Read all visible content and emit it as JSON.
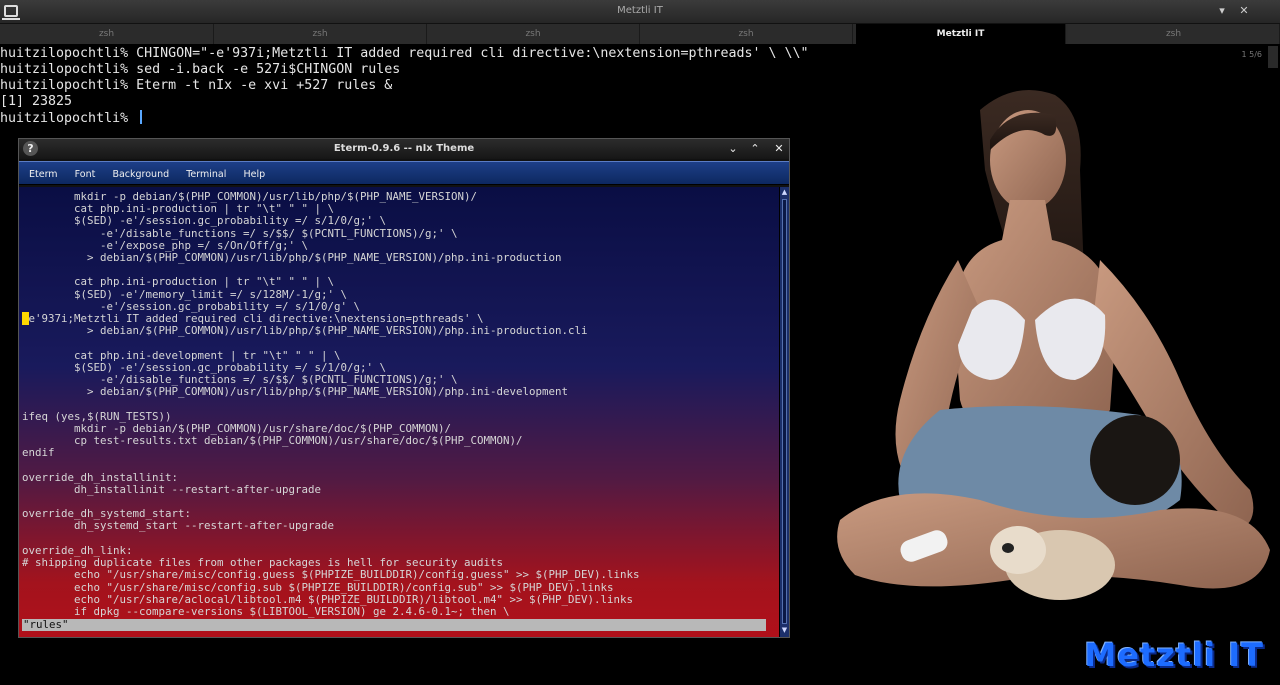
{
  "window": {
    "title": "Metztli IT",
    "controls": [
      "▾",
      "✕"
    ]
  },
  "tabs": [
    {
      "label": "zsh",
      "active": false
    },
    {
      "label": "zsh",
      "active": false
    },
    {
      "label": "zsh",
      "active": false
    },
    {
      "label": "zsh",
      "active": false
    },
    {
      "label": "Metztli IT",
      "active": true
    },
    {
      "label": "zsh",
      "active": false
    }
  ],
  "scroll_indicator": "1 5/6",
  "terminal": {
    "lines": [
      "huitzilopochtli% CHINGON=\"-e'937i;Metztli IT added required cli directive:\\nextension=pthreads' \\ \\\\\"",
      "huitzilopochtli% sed -i.back -e 527i$CHINGON rules",
      "huitzilopochtli% Eterm -t nIx -e xvi +527 rules &",
      "[1] 23825",
      "huitzilopochtli% "
    ]
  },
  "eterm": {
    "title": "Eterm-0.9.6 -- nIx Theme",
    "help_icon": "?",
    "title_controls": [
      "⌄",
      "⌃",
      "✕"
    ],
    "menu": [
      "Eterm",
      "Font",
      "Background",
      "Terminal",
      "Help"
    ],
    "lines": [
      "        mkdir -p debian/$(PHP_COMMON)/usr/lib/php/$(PHP_NAME_VERSION)/",
      "        cat php.ini-production | tr \"\\t\" \" \" | \\",
      "        $(SED) -e'/session.gc_probability =/ s/1/0/g;' \\",
      "            -e'/disable_functions =/ s/$$/ $(PCNTL_FUNCTIONS)/g;' \\",
      "            -e'/expose_php =/ s/On/Off/g;' \\",
      "          > debian/$(PHP_COMMON)/usr/lib/php/$(PHP_NAME_VERSION)/php.ini-production",
      "",
      "        cat php.ini-production | tr \"\\t\" \" \" | \\",
      "        $(SED) -e'/memory_limit =/ s/128M/-1/g;' \\",
      "            -e'/session.gc_probability =/ s/1/0/g' \\",
      "-e'937i;Metztli IT added required cli directive:\\nextension=pthreads' \\",
      "          > debian/$(PHP_COMMON)/usr/lib/php/$(PHP_NAME_VERSION)/php.ini-production.cli",
      "",
      "        cat php.ini-development | tr \"\\t\" \" \" | \\",
      "        $(SED) -e'/session.gc_probability =/ s/1/0/g;' \\",
      "            -e'/disable_functions =/ s/$$/ $(PCNTL_FUNCTIONS)/g;' \\",
      "          > debian/$(PHP_COMMON)/usr/lib/php/$(PHP_NAME_VERSION)/php.ini-development",
      "",
      "ifeq (yes,$(RUN_TESTS))",
      "        mkdir -p debian/$(PHP_COMMON)/usr/share/doc/$(PHP_COMMON)/",
      "        cp test-results.txt debian/$(PHP_COMMON)/usr/share/doc/$(PHP_COMMON)/",
      "endif",
      "",
      "override_dh_installinit:",
      "        dh_installinit --restart-after-upgrade",
      "",
      "override_dh_systemd_start:",
      "        dh_systemd_start --restart-after-upgrade",
      "",
      "override_dh_link:",
      "# shipping duplicate files from other packages is hell for security audits",
      "        echo \"/usr/share/misc/config.guess $(PHPIZE_BUILDDIR)/config.guess\" >> $(PHP_DEV).links",
      "        echo \"/usr/share/misc/config.sub $(PHPIZE_BUILDDIR)/config.sub\" >> $(PHP_DEV).links",
      "        echo \"/usr/share/aclocal/libtool.m4 $(PHPIZE_BUILDDIR)/libtool.m4\" >> $(PHP_DEV).links",
      "        if dpkg --compare-versions $(LIBTOOL_VERSION) ge 2.4.6-0.1~; then \\"
    ],
    "status_line": "\"rules\""
  },
  "brand_text": "Metztli IT",
  "colors": {
    "accent": "#1d6cff",
    "menubar": "#1d3f88",
    "cursor": "#ffd800"
  }
}
